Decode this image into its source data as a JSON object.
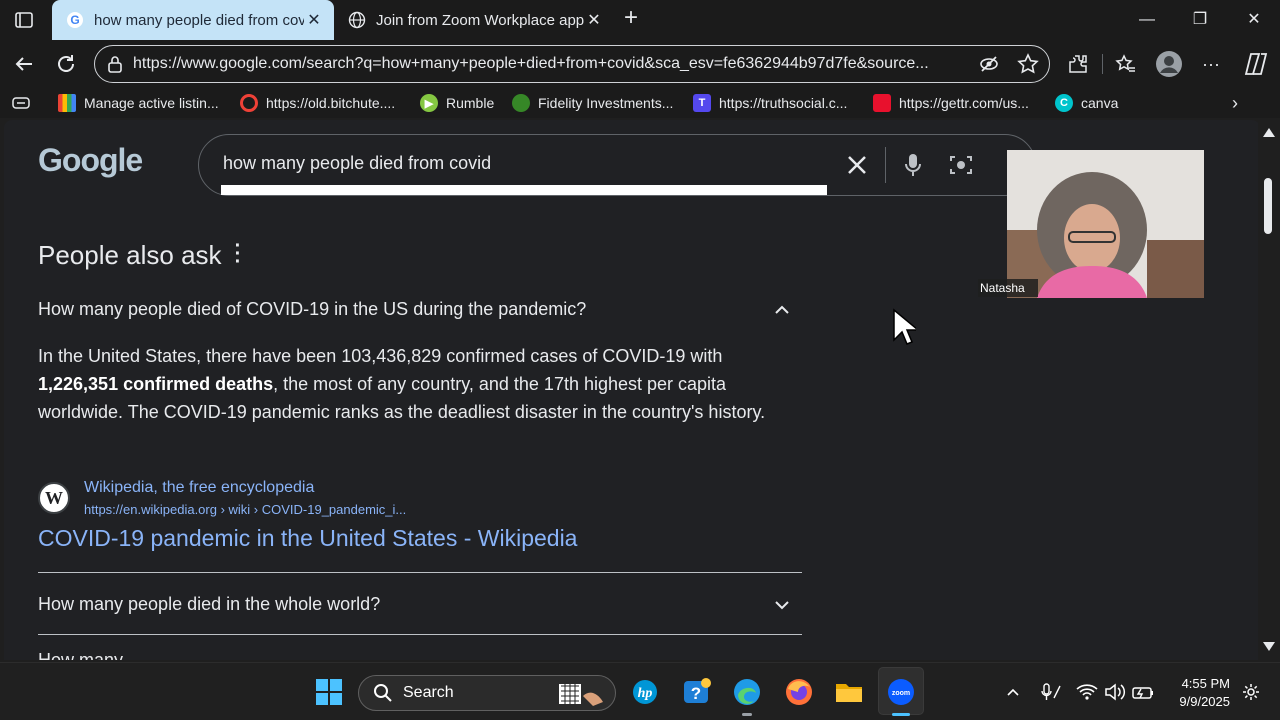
{
  "browser": {
    "tabs": [
      {
        "label": "how many people died from covi",
        "active": true
      },
      {
        "label": "Join from Zoom Workplace app -",
        "active": false
      }
    ],
    "url": "https://www.google.com/search?q=how+many+people+died+from+covid&sca_esv=fe6362944b97d7fe&source...",
    "bookmarks": [
      {
        "label": "Manage active listin...",
        "icon": "multicolor-grid-icon",
        "color": "#ea4335"
      },
      {
        "label": "https://old.bitchute....",
        "icon": "bitchute-icon",
        "color": "#ef4137"
      },
      {
        "label": "Rumble",
        "icon": "rumble-icon",
        "color": "#85c742"
      },
      {
        "label": "Fidelity Investments...",
        "icon": "fidelity-icon",
        "color": "#368727"
      },
      {
        "label": "https://truthsocial.c...",
        "icon": "truthsocial-icon",
        "color": "#5448ee"
      },
      {
        "label": "https://gettr.com/us...",
        "icon": "gettr-icon",
        "color": "#e8112d"
      },
      {
        "label": "canva",
        "icon": "canva-icon",
        "color": "#00c4cc"
      }
    ]
  },
  "google": {
    "logo": "Google",
    "query": "how many people died from covid",
    "paa_title": "People also ask",
    "questions": [
      {
        "text": "How many people died of COVID-19 in the US during the pandemic?",
        "expanded": true
      },
      {
        "text": "How many people died in the whole world?",
        "expanded": false
      },
      {
        "text": "How many ...",
        "expanded": false
      }
    ],
    "answer_pre": "In the United States, there have been 103,436,829 confirmed cases of COVID-19 with ",
    "answer_bold": "1,226,351 confirmed deaths",
    "answer_post": ", the most of any country, and the 17th highest per capita worldwide. The COVID-19 pandemic ranks as the deadliest disaster in the country's history.",
    "source_name": "Wikipedia, the free encyclopedia",
    "source_url": "https://en.wikipedia.org › wiki › COVID-19_pandemic_i...",
    "source_title": "COVID-19 pandemic in the United States - Wikipedia",
    "source_icon_letter": "W"
  },
  "zoom": {
    "participant_name": "Natasha"
  },
  "taskbar": {
    "search_label": "Search",
    "time": "4:55 PM",
    "date": "9/9/2025"
  },
  "colors": {
    "link": "#8ab4f8",
    "page_bg": "#202124",
    "active_tab": "#c4e3f7"
  }
}
